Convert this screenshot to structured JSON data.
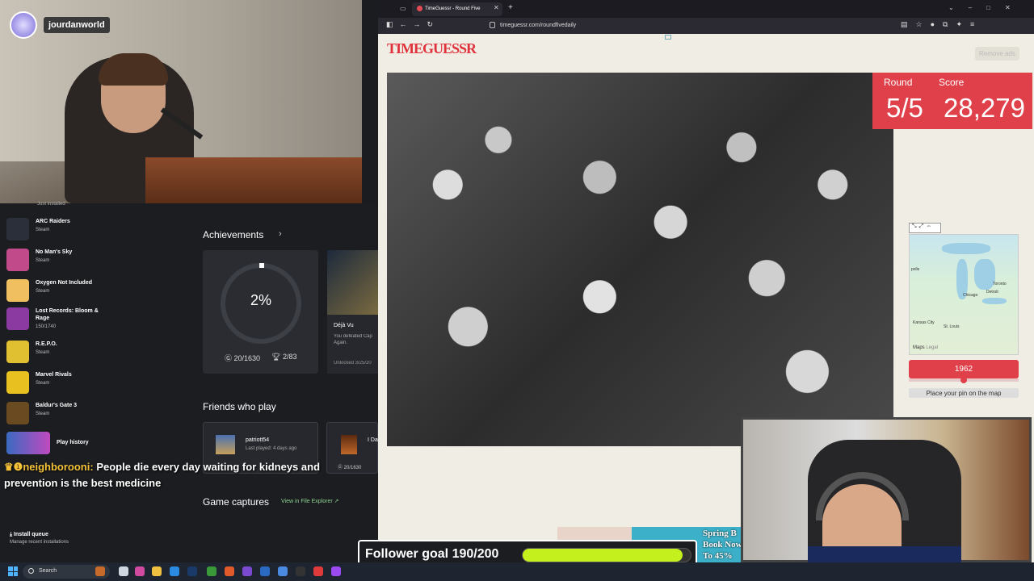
{
  "stream": {
    "username": "jourdanworld"
  },
  "library": {
    "items": [
      {
        "name": "ARC Raiders",
        "sub": "Steam",
        "color": "#2a2f3a"
      },
      {
        "name": "No Man's Sky",
        "sub": "Steam",
        "color": "#c04a8a"
      },
      {
        "name": "Oxygen Not Included",
        "sub": "Steam",
        "color": "#f0c060"
      },
      {
        "name": "Lost Records: Bloom & Rage",
        "sub": "150/1740",
        "color": "#8a3aa0"
      },
      {
        "name": "R.E.P.O.",
        "sub": "Steam",
        "color": "#e0c030"
      },
      {
        "name": "Marvel Rivals",
        "sub": "Steam",
        "color": "#e8c020"
      },
      {
        "name": "Baldur's Gate 3",
        "sub": "Steam",
        "color": "#6a4a20"
      }
    ],
    "play_history": "Play history",
    "just_installed": "Just installed",
    "install_queue": {
      "title": "Install queue",
      "sub": "Manage recent installations"
    }
  },
  "achievements": {
    "title": "Achievements",
    "percent": "2%",
    "gamerscore": "20/1630",
    "trophies": "2/83",
    "deja_title": "Déjà Vu",
    "deja_desc": "You defeated Cap",
    "deja_desc2": "Again.",
    "deja_unlocked": "Unlocked 3/25/20"
  },
  "friends": {
    "title": "Friends who play",
    "friend1_name": "patriott54",
    "friend1_last": "Last played: 4 days ago",
    "friend2_name": "I Da",
    "friend2_score": "20/1630"
  },
  "captures": {
    "title": "Game captures",
    "link": "View in File Explorer"
  },
  "chat": {
    "user": "neighborooni:",
    "message": "People die every day waiting for kidneys and prevention is the best medicine"
  },
  "browser": {
    "tab_title": "TimeGuessr - Round Five",
    "url": "timeguessr.com/roundfivedaily",
    "logo": "TIMEGUESSR",
    "remove_ads": "Remove ads"
  },
  "game": {
    "round_label": "Round",
    "score_label": "Score",
    "round_value": "5/5",
    "score_value": "28,279",
    "year": "1962",
    "year_fraction": 0.5,
    "place_pin": "Place your pin on the map",
    "map_brand": "Maps",
    "map_legal": "Legal",
    "cities": [
      "Toronto",
      "Detroit",
      "Chicago",
      "Kansas City",
      "St. Louis",
      "polis"
    ]
  },
  "ad": {
    "line1": "Spring B",
    "line2": "Book Now",
    "line3": "To 45% "
  },
  "goal": {
    "text": "Follower goal 190/200",
    "current": 190,
    "target": 200
  },
  "taskbar": {
    "search": "Search"
  }
}
